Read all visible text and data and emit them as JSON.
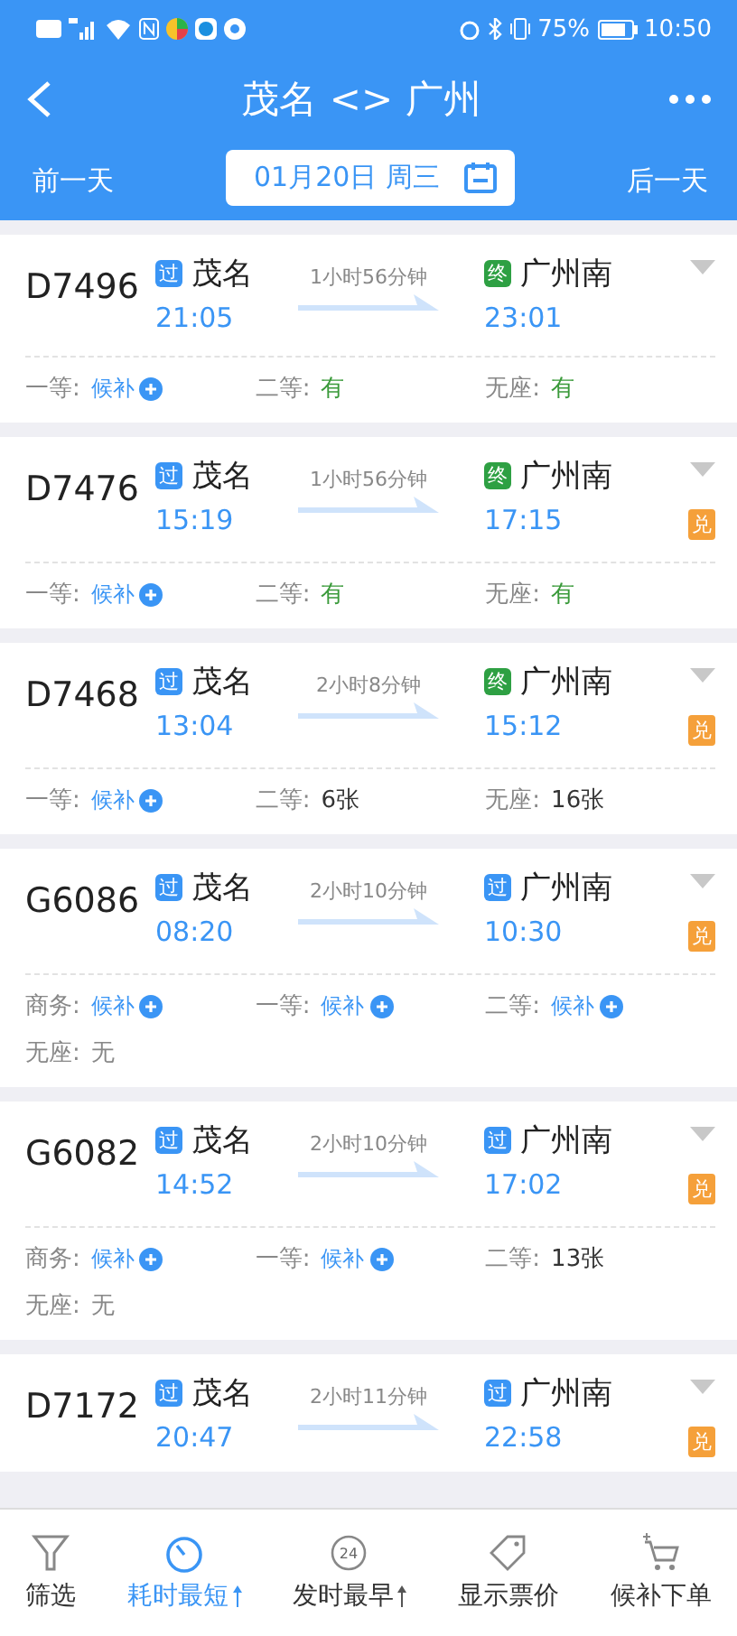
{
  "status_bar": {
    "battery": "75%",
    "time": "10:50"
  },
  "title_bar": {
    "title": "茂名 <> 广州"
  },
  "date_bar": {
    "prev": "前一天",
    "date": "01月20日 周三",
    "next": "后一天"
  },
  "trains": [
    {
      "number": "D7496",
      "from_tag": {
        "text": "过",
        "kind": "pass"
      },
      "from": "茂名",
      "depart": "21:05",
      "duration": "1小时56分钟",
      "to_tag": {
        "text": "终",
        "kind": "terminal"
      },
      "to": "广州南",
      "arrive": "23:01",
      "seats": [
        {
          "label": "一等:",
          "value": "候补",
          "kind": "waitlist"
        },
        {
          "label": "二等:",
          "value": "有",
          "kind": "available"
        },
        {
          "label": "无座:",
          "value": "有",
          "kind": "available"
        }
      ]
    },
    {
      "number": "D7476",
      "from_tag": {
        "text": "过",
        "kind": "pass"
      },
      "from": "茂名",
      "depart": "15:19",
      "duration": "1小时56分钟",
      "to_tag": {
        "text": "终",
        "kind": "terminal"
      },
      "to": "广州南",
      "arrive": "17:15",
      "exchange": "兑",
      "seats": [
        {
          "label": "一等:",
          "value": "候补",
          "kind": "waitlist"
        },
        {
          "label": "二等:",
          "value": "有",
          "kind": "available"
        },
        {
          "label": "无座:",
          "value": "有",
          "kind": "available"
        }
      ]
    },
    {
      "number": "D7468",
      "from_tag": {
        "text": "过",
        "kind": "pass"
      },
      "from": "茂名",
      "depart": "13:04",
      "duration": "2小时8分钟",
      "to_tag": {
        "text": "终",
        "kind": "terminal"
      },
      "to": "广州南",
      "arrive": "15:12",
      "exchange": "兑",
      "seats": [
        {
          "label": "一等:",
          "value": "候补",
          "kind": "waitlist"
        },
        {
          "label": "二等:",
          "value": "6张",
          "kind": "count"
        },
        {
          "label": "无座:",
          "value": "16张",
          "kind": "count"
        }
      ]
    },
    {
      "number": "G6086",
      "from_tag": {
        "text": "过",
        "kind": "pass"
      },
      "from": "茂名",
      "depart": "08:20",
      "duration": "2小时10分钟",
      "to_tag": {
        "text": "过",
        "kind": "pass"
      },
      "to": "广州南",
      "arrive": "10:30",
      "exchange": "兑",
      "seats": [
        {
          "label": "商务:",
          "value": "候补",
          "kind": "waitlist"
        },
        {
          "label": "一等:",
          "value": "候补",
          "kind": "waitlist"
        },
        {
          "label": "二等:",
          "value": "候补",
          "kind": "waitlist"
        },
        {
          "label": "无座:",
          "value": "无",
          "kind": "none"
        }
      ]
    },
    {
      "number": "G6082",
      "from_tag": {
        "text": "过",
        "kind": "pass"
      },
      "from": "茂名",
      "depart": "14:52",
      "duration": "2小时10分钟",
      "to_tag": {
        "text": "过",
        "kind": "pass"
      },
      "to": "广州南",
      "arrive": "17:02",
      "exchange": "兑",
      "seats": [
        {
          "label": "商务:",
          "value": "候补",
          "kind": "waitlist"
        },
        {
          "label": "一等:",
          "value": "候补",
          "kind": "waitlist"
        },
        {
          "label": "二等:",
          "value": "13张",
          "kind": "count"
        },
        {
          "label": "无座:",
          "value": "无",
          "kind": "none"
        }
      ]
    },
    {
      "number": "D7172",
      "from_tag": {
        "text": "过",
        "kind": "pass"
      },
      "from": "茂名",
      "depart": "20:47",
      "duration": "2小时11分钟",
      "to_tag": {
        "text": "过",
        "kind": "pass"
      },
      "to": "广州南",
      "arrive": "22:58",
      "exchange": "兑"
    }
  ],
  "bottom_tabs": [
    {
      "label": "筛选",
      "kind": "filter",
      "selected": false,
      "sortable": false
    },
    {
      "label": "耗时最短",
      "kind": "stopwatch",
      "selected": true,
      "sortable": true
    },
    {
      "label": "发时最早",
      "kind": "clock",
      "icon_text": "24",
      "selected": false,
      "sortable": true
    },
    {
      "label": "显示票价",
      "kind": "tag",
      "selected": false,
      "sortable": false
    },
    {
      "label": "候补下单",
      "kind": "cart",
      "selected": false,
      "sortable": false
    }
  ]
}
